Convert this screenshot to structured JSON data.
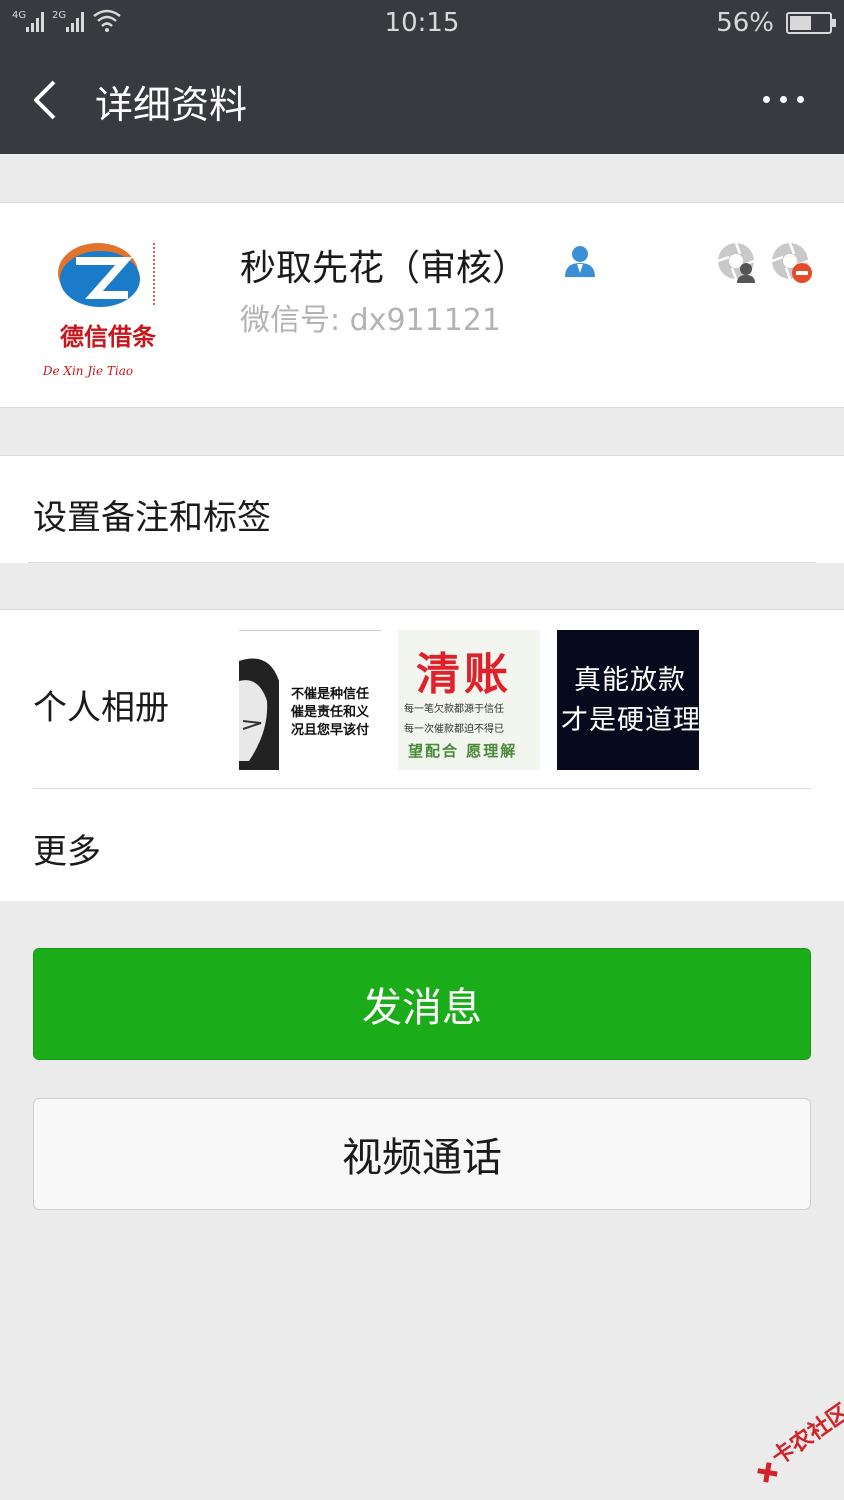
{
  "status": {
    "network1": "4G",
    "network2": "2G",
    "time": "10:15",
    "battery_percent": "56%",
    "battery_level": 0.56
  },
  "nav": {
    "title": "详细资料"
  },
  "profile": {
    "name": "秒取先花（审核）",
    "wechat_id": "微信号: dx911121",
    "avatar_logo_text": "德信借条",
    "avatar_logo_sub": "De Xin Jie Tiao"
  },
  "remark": {
    "label": "设置备注和标签"
  },
  "album": {
    "label": "个人相册",
    "thumbs": {
      "t1_lines": [
        "不催是种信任",
        "催是责任和义",
        "况且您早该付"
      ],
      "t2_title": "清账",
      "t2_lines": [
        "每一笔欠款都源于信任",
        "每一次催款都迫不得已"
      ],
      "t2_foot": "望配合 愿理解",
      "t3_lines": [
        "真能放款",
        "才是硬道理"
      ]
    },
    "more_label": "更多"
  },
  "actions": {
    "send_message": "发消息",
    "video_call": "视频通话"
  },
  "watermark": {
    "text": "卡农社区"
  },
  "colors": {
    "header": "#393a3f",
    "primary_green": "#1aad19",
    "background": "#ebebeb"
  }
}
